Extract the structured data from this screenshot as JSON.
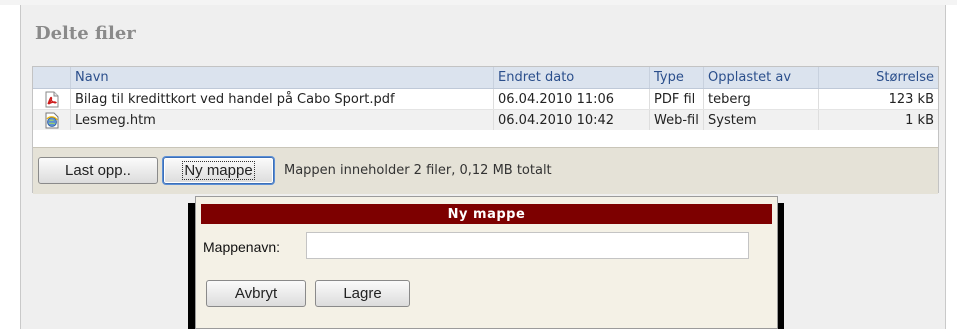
{
  "panel": {
    "title": "Delte filer"
  },
  "table": {
    "headers": {
      "name": "Navn",
      "date": "Endret dato",
      "type": "Type",
      "uploaded_by": "Opplastet av",
      "size": "Størrelse"
    },
    "rows": [
      {
        "icon": "pdf-file-icon",
        "name": "Bilag til kredittkort ved handel på Cabo Sport.pdf",
        "date": "06.04.2010 11:06",
        "type": "PDF fil",
        "uploaded_by": "teberg",
        "size": "123 kB"
      },
      {
        "icon": "web-file-icon",
        "name": "Lesmeg.htm",
        "date": "06.04.2010 10:42",
        "type": "Web-fil",
        "uploaded_by": "System",
        "size": "1 kB"
      }
    ]
  },
  "toolbar": {
    "upload_label": "Last opp..",
    "new_folder_label": "Ny mappe",
    "info": "Mappen inneholder 2 filer, 0,12 MB totalt"
  },
  "dialog": {
    "title": "Ny mappe",
    "field_label": "Mappenavn:",
    "field_value": "",
    "cancel_label": "Avbryt",
    "save_label": "Lagre"
  },
  "colors": {
    "dialog_title_bg": "#7d0000",
    "table_header_bg": "#dbe3ee",
    "table_header_text": "#2b4f8c",
    "toolbar_bg": "#e5e2d7"
  }
}
